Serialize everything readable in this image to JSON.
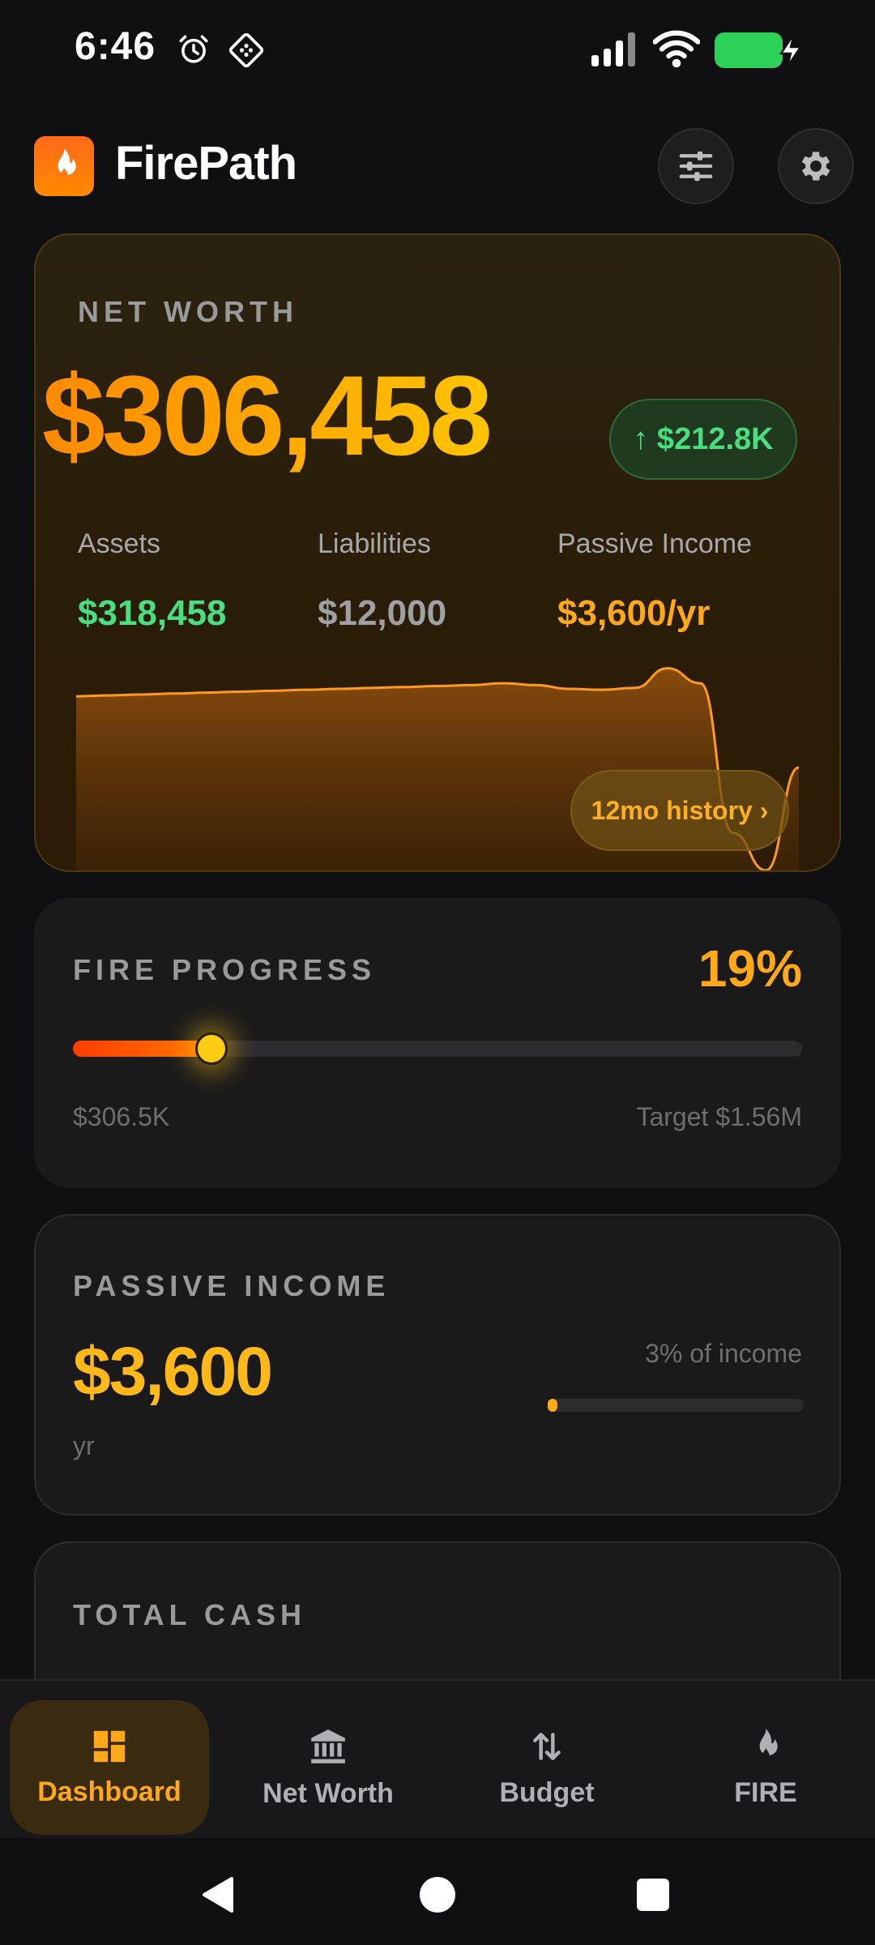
{
  "status_bar": {
    "time": "6:46",
    "icons": [
      "alarm-icon",
      "nfc-icon",
      "signal-icon",
      "wifi-icon",
      "battery-charging-icon"
    ]
  },
  "header": {
    "app_name": "FirePath",
    "logo_icon": "flame-icon",
    "actions": [
      "sliders-icon",
      "gear-icon"
    ]
  },
  "net_worth": {
    "label": "NET WORTH",
    "value": "$306,458",
    "change": "↑ $212.8K",
    "assets_label": "Assets",
    "assets_value": "$318,458",
    "liabilities_label": "Liabilities",
    "liabilities_value": "$12,000",
    "passive_label": "Passive Income",
    "passive_value": "$3,600/yr",
    "history_button": "12mo history ›"
  },
  "chart_data": {
    "type": "area",
    "title": "",
    "xlabel": "",
    "ylabel": "",
    "grid": false,
    "series": [
      {
        "values": [
          0.93,
          0.935,
          0.94,
          0.945,
          0.95,
          0.955,
          0.96,
          0.965,
          0.97,
          0.975,
          0.98,
          0.985,
          0.99,
          1.0,
          0.99,
          0.97,
          0.965,
          0.975,
          1.08,
          1.0,
          0.2,
          0.0,
          0.55
        ]
      }
    ]
  },
  "fire_progress": {
    "label": "FIRE PROGRESS",
    "percent_text": "19%",
    "progress": 0.19,
    "current": "$306.5K",
    "target": "Target $1.56M"
  },
  "passive_income": {
    "label": "PASSIVE INCOME",
    "value": "$3,600",
    "period": "yr",
    "share_text": "3% of income",
    "share": 0.03
  },
  "total_cash": {
    "label": "TOTAL CASH"
  },
  "bottom_nav": {
    "items": [
      {
        "label": "Dashboard",
        "icon": "dashboard-icon",
        "active": true
      },
      {
        "label": "Net Worth",
        "icon": "bank-icon",
        "active": false
      },
      {
        "label": "Budget",
        "icon": "transfer-arrows-icon",
        "active": false
      },
      {
        "label": "FIRE",
        "icon": "flame-icon",
        "active": false
      }
    ]
  },
  "colors": {
    "accent": "#ffa81a",
    "positive": "#4ade80",
    "background": "#101012",
    "card": "#1a1a1b"
  }
}
